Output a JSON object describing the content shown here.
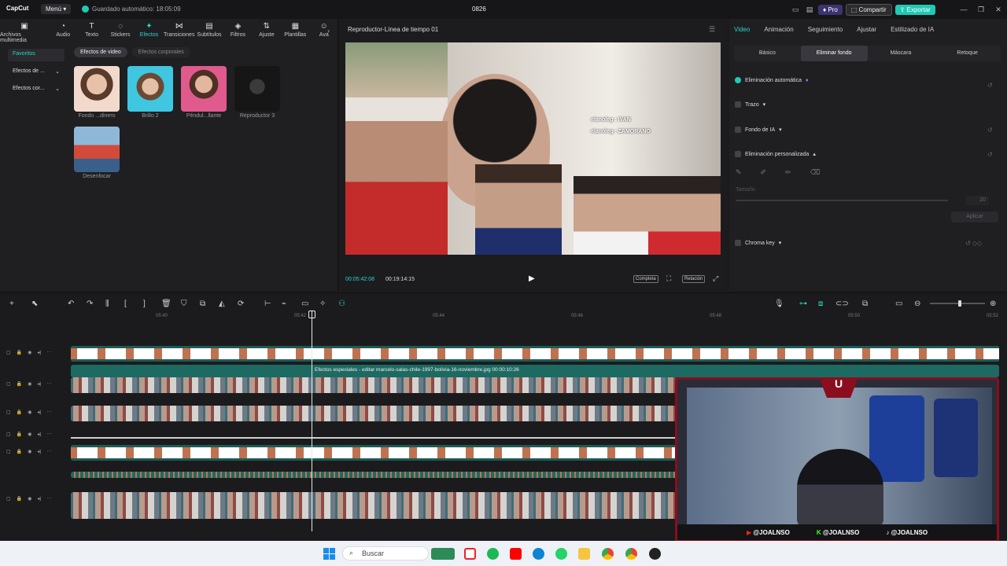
{
  "titlebar": {
    "app_name": "CapCut",
    "menu_label": "Menú",
    "autosave": "Guardado automático: 18:05:09",
    "project_title": "0826",
    "pro_label": "Pro",
    "share_label": "Compartir",
    "export_label": "Exportar"
  },
  "toolbar": {
    "items": [
      {
        "label": "Archivos multimedia",
        "icon": "media-icon"
      },
      {
        "label": "Audio",
        "icon": "audio-icon"
      },
      {
        "label": "Texto",
        "icon": "text-icon"
      },
      {
        "label": "Stickers",
        "icon": "sticker-icon"
      },
      {
        "label": "Efectos",
        "icon": "effects-icon",
        "active": true
      },
      {
        "label": "Transiciones",
        "icon": "transition-icon"
      },
      {
        "label": "Subtítulos",
        "icon": "subtitle-icon"
      },
      {
        "label": "Filtros",
        "icon": "filter-icon"
      },
      {
        "label": "Ajuste",
        "icon": "adjust-icon"
      },
      {
        "label": "Plantillas",
        "icon": "template-icon"
      },
      {
        "label": "Ava",
        "icon": "avatar-icon"
      }
    ]
  },
  "sidebar": {
    "items": [
      {
        "label": "Favoritos",
        "active": true
      },
      {
        "label": "Efectos de ..."
      },
      {
        "label": "Efectos cor..."
      }
    ]
  },
  "effects": {
    "tabs": [
      "Efectos de video",
      "Efectos corporales"
    ],
    "items": [
      {
        "label": "Fondo ...dinero"
      },
      {
        "label": "Brillo 2"
      },
      {
        "label": "Péndul...llante"
      },
      {
        "label": "Reproductor 3"
      },
      {
        "label": "Desenfocar"
      }
    ]
  },
  "player": {
    "title": "Reproductor-Línea de tiempo 01",
    "current_time": "00:05:42:08",
    "total_time": "00:19:14:15",
    "full_label": "Completa",
    "ratio_label": "Relación",
    "overlay_line1": "elanoleg : IVAN",
    "overlay_line2": "elanoleg : ZAMORANO"
  },
  "props": {
    "tabs": [
      "Video",
      "Animación",
      "Seguimiento",
      "Ajustar",
      "Estilizado de IA"
    ],
    "subtabs": [
      "Básico",
      "Eliminar fondo",
      "Máscara",
      "Retoque"
    ],
    "auto_remove": "Eliminación automática",
    "stroke": "Trazo",
    "ai_bg": "Fondo de IA",
    "custom_remove": "Eliminación personalizada",
    "size_label": "Tamaño",
    "size_value": "20",
    "apply_label": "Aplicar",
    "chroma": "Chroma key"
  },
  "timeline": {
    "ticks": [
      "05:40",
      "05:42",
      "05:44",
      "05:46",
      "05:48",
      "05:50",
      "05:52"
    ],
    "fx_clip_label": "Efectos especiales - editar  marcelo-salas-chile-1997-bolivia-16-noviembre.jpg  00:00:10:26"
  },
  "webcam": {
    "youtube": "@JOALNSO",
    "kick": "@JOALNSO",
    "tiktok": "@JOALNSO"
  },
  "taskbar": {
    "search_label": "Buscar"
  },
  "colors": {
    "accent": "#1fc9b5",
    "export": "#1fc9b5",
    "frame_red": "#8a0e1d"
  }
}
